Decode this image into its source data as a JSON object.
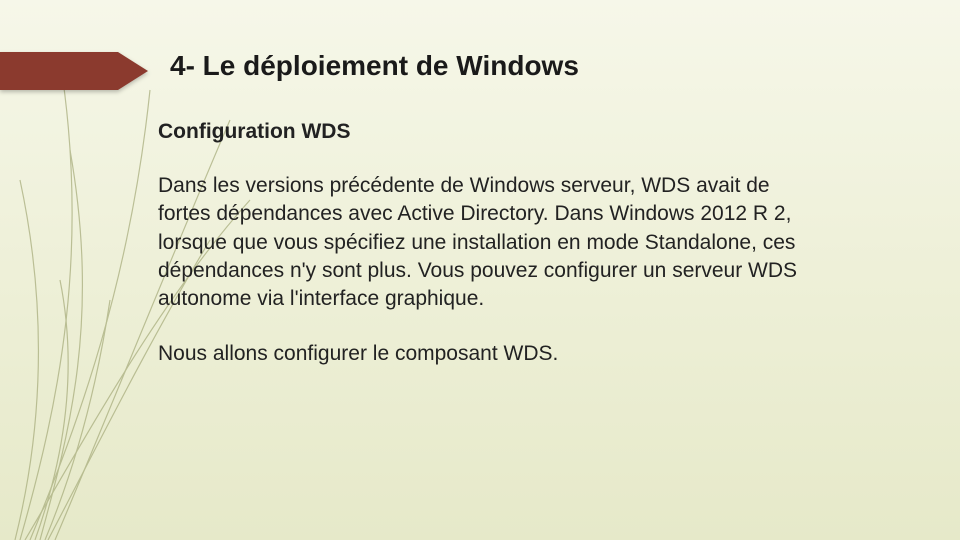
{
  "slide": {
    "title": "4- Le déploiement de Windows",
    "subheading": "Configuration WDS",
    "paragraph1": "Dans les versions précédente de Windows serveur, WDS avait de fortes dépendances avec Active Directory. Dans Windows 2012 R 2, lorsque que vous spécifiez une installation en mode Standalone, ces dépendances n'y sont plus. Vous pouvez configurer un serveur WDS autonome via l'interface graphique.",
    "paragraph2": "Nous allons configurer le composant WDS."
  },
  "theme": {
    "accent": "#8b3a2e",
    "bg_top": "#f6f7e9",
    "bg_bottom": "#e6e9c9"
  }
}
